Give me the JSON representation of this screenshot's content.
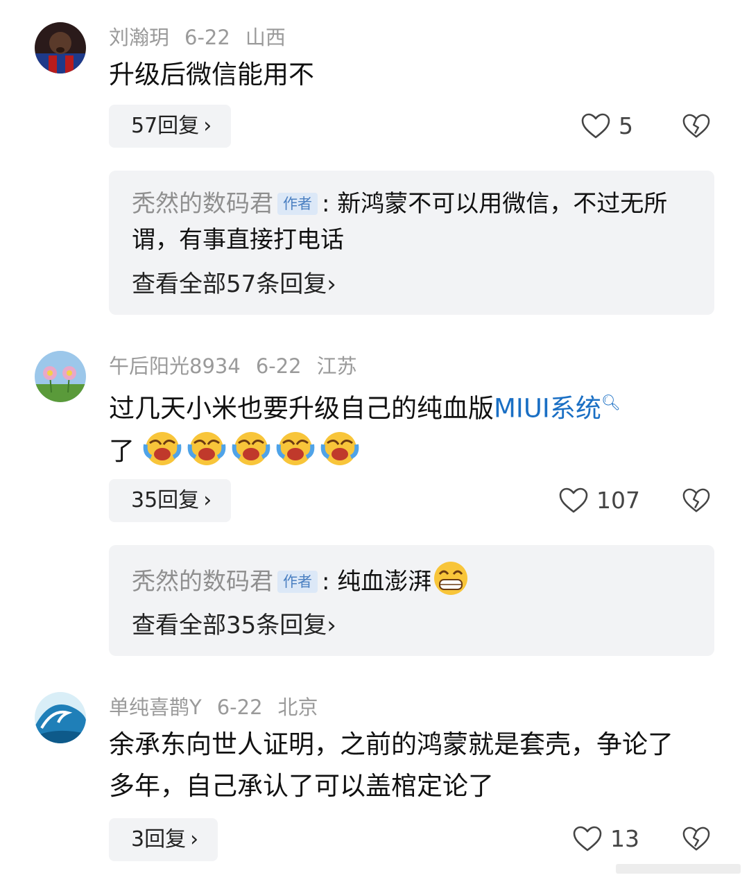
{
  "comments": [
    {
      "user": "刘瀚玥",
      "date": "6-22",
      "location": "山西",
      "text": "升级后微信能用不",
      "reply_label": "57回复",
      "likes": "5",
      "sub": {
        "author": "秃然的数码君",
        "tag": "作者",
        "text": "新鸿蒙不可以用微信，不过无所谓，有事直接打电话",
        "view_all": "查看全部57条回复"
      }
    },
    {
      "user": "午后阳光8934",
      "date": "6-22",
      "location": "江苏",
      "text_before": "过几天小米也要升级自己的纯血版",
      "link": "MIUI系统",
      "text_after": "了",
      "reply_label": "35回复",
      "likes": "107",
      "sub": {
        "author": "秃然的数码君",
        "tag": "作者",
        "text": "纯血澎湃",
        "view_all": "查看全部35条回复"
      }
    },
    {
      "user": "单纯喜鹊Y",
      "date": "6-22",
      "location": "北京",
      "text": "余承东向世人证明，之前的鸿蒙就是套壳，争论了多年，自己承认了可以盖棺定论了",
      "reply_label": "3回复",
      "likes": "13"
    }
  ],
  "ui": {
    "chevron": "›",
    "colon": ":",
    "link_color": "#1a6fc4",
    "panel_bg": "#f2f3f5"
  }
}
